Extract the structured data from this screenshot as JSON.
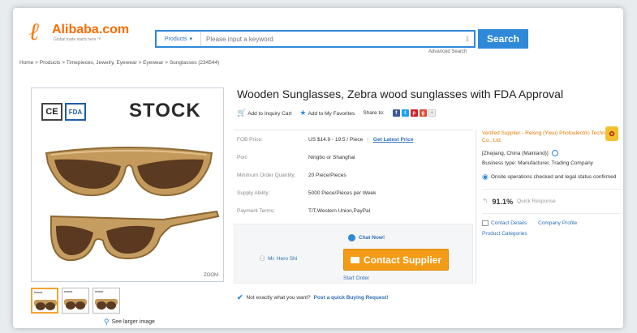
{
  "logo": {
    "name": "Alibaba.com",
    "tagline": "Global trade starts here.™"
  },
  "search": {
    "category": "Products",
    "placeholder": "Please input a keyword",
    "button": "Search",
    "advanced": "Advanced Search"
  },
  "breadcrumb": "Home > Products > Timepieces, Jewelry, Eyewear > Eyewear > Sunglasses (234544)",
  "gallery": {
    "badge_ce": "CE",
    "badge_fda": "FDA",
    "stock_text": "STOCK",
    "zoom": "ZOOM",
    "see_larger": "See larger image",
    "thumbs": [
      "STOCK",
      "STOCK",
      "STOCK"
    ]
  },
  "product": {
    "title": "Wooden Sunglasses, Zebra wood sunglasses with FDA Approval",
    "add_inquiry": "Add to Inquiry Cart",
    "add_favorites": "Add to My Favorites",
    "share": "Share to:",
    "specs": [
      {
        "label": "FOB Price:",
        "value": "US $14.9 - 19.5 / Piece",
        "link": "Get Latest Price"
      },
      {
        "label": "Port:",
        "value": "Ningbo or Shanghai"
      },
      {
        "label": "Minimum Order Quantity:",
        "value": "20 Piece/Pieces"
      },
      {
        "label": "Supply Ability:",
        "value": "5000 Piece/Pieces per Week"
      },
      {
        "label": "Payment Terms:",
        "value": "T/T,Western Union,PayPal"
      }
    ]
  },
  "contact": {
    "person": "Mr. Hero Shi",
    "chat": "Chat Now!",
    "button": "Contact Supplier",
    "start_order": "Start Order"
  },
  "buying_request": {
    "prefix": "Not exactly what you want?",
    "link": "Post a quick Buying Request!"
  },
  "supplier": {
    "verified_label": "Verified Supplier",
    "verified_rest": " - Reisng (Yiwu) Photoelectric Technology Co., Ltd.",
    "location": "[Zhejiang, China (Mainland)]",
    "business_type": "Business type: Manufacturer, Trading Company",
    "onsite": "Onsite operations checked and legal status confirmed",
    "rate": "91.1%",
    "rate_label": "Quick Response",
    "contact_details": "Contact Details",
    "company_profile": "Company Profile",
    "product_categories": "Product Categories"
  },
  "colors": {
    "accent_blue": "#2f89d8",
    "brand_orange": "#ff6a00",
    "contact_orange": "#f39a16",
    "verified_orange": "#e37a00"
  }
}
